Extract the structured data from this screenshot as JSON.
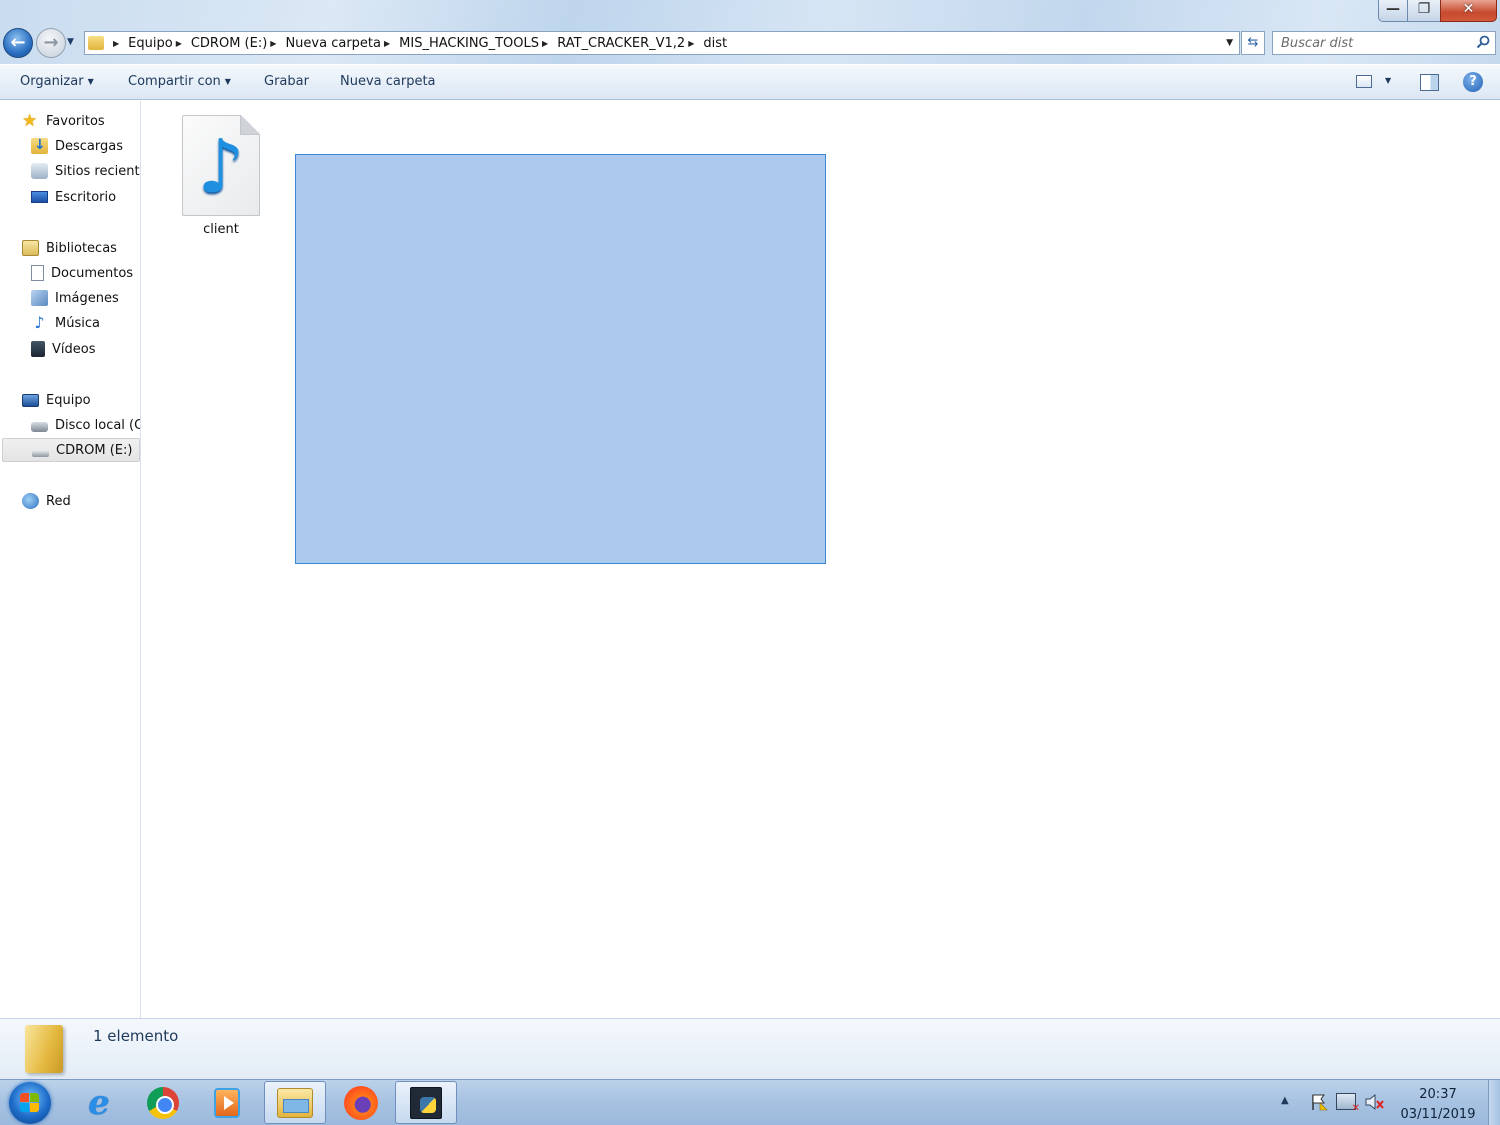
{
  "window": {
    "controls": {
      "minimize_glyph": "—",
      "maximize_glyph": "❐",
      "close_glyph": "✕"
    }
  },
  "address_bar": {
    "breadcrumbs": [
      "Equipo",
      "CDROM (E:)",
      "Nueva carpeta",
      "MIS_HACKING_TOOLS",
      "RAT_CRACKER_V1,2",
      "dist"
    ]
  },
  "search": {
    "placeholder": "Buscar dist"
  },
  "command_bar": {
    "organize": "Organizar",
    "share": "Compartir con",
    "burn": "Grabar",
    "new_folder": "Nueva carpeta",
    "help": "?"
  },
  "nav_pane": {
    "favorites": {
      "label": "Favoritos",
      "items": [
        "Descargas",
        "Sitios recientes",
        "Escritorio"
      ]
    },
    "libraries": {
      "label": "Bibliotecas",
      "items": [
        "Documentos",
        "Imágenes",
        "Música",
        "Vídeos"
      ]
    },
    "computer": {
      "label": "Equipo",
      "items": [
        "Disco local (C:)",
        "CDROM (E:)"
      ],
      "selected": "CDROM (E:)"
    },
    "network": {
      "label": "Red"
    }
  },
  "content": {
    "files": [
      {
        "name": "client",
        "icon": "audio-file-icon"
      }
    ]
  },
  "details_pane": {
    "item_count": "1 elemento"
  },
  "taskbar": {
    "pinned": [
      "start-button",
      "internet-explorer-icon",
      "chrome-icon",
      "media-player-icon",
      "explorer-icon",
      "firefox-icon",
      "python-icon"
    ],
    "active": "explorer-icon",
    "clock": {
      "time": "20:37",
      "date": "03/11/2019"
    }
  },
  "colors": {
    "selection_fill": "#8fbce8",
    "selection_border": "#3e86d6",
    "accent": "#1e395b"
  }
}
